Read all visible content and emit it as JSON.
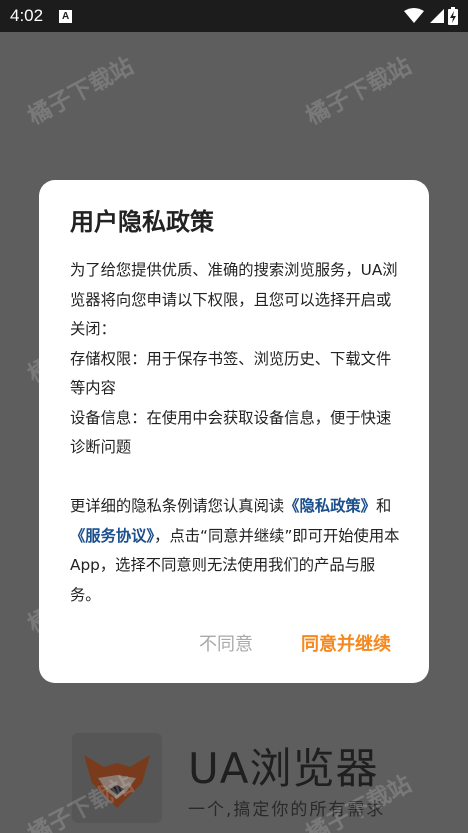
{
  "status_bar": {
    "time": "4:02",
    "notif": "A"
  },
  "splash": {
    "app_name": "UA浏览器",
    "slogan": "一个,搞定你的所有需求"
  },
  "watermark": "橘子下载站",
  "dialog": {
    "title": "用户隐私政策",
    "p1": "为了给您提供优质、准确的搜索浏览服务，UA浏览器将向您申请以下权限，且您可以选择开启或关闭：",
    "p2": "存储权限：用于保存书签、浏览历史、下载文件等内容",
    "p3": "设备信息：在使用中会获取设备信息，便于快速诊断问题",
    "p4_prefix": "更详细的隐私条例请您认真阅读",
    "privacy_link": "《隐私政策》",
    "and": "和",
    "service_link": "《服务协议》",
    "p4_suffix": "，点击“同意并继续”即可开始使用本App，选择不同意则无法使用我们的产品与服务。",
    "disagree": "不同意",
    "agree": "同意并继续"
  }
}
